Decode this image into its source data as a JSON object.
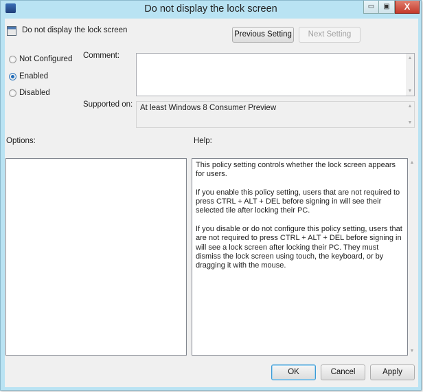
{
  "window": {
    "title": "Do not display the lock screen",
    "minimize": "▭",
    "maximize": "▣",
    "close": "X"
  },
  "header": {
    "policy_name": "Do not display the lock screen",
    "previous_label": "Previous Setting",
    "next_label": "Next Setting"
  },
  "state": {
    "options": [
      {
        "label": "Not Configured",
        "selected": false
      },
      {
        "label": "Enabled",
        "selected": true
      },
      {
        "label": "Disabled",
        "selected": false
      }
    ]
  },
  "comment": {
    "label": "Comment:",
    "value": ""
  },
  "supported": {
    "label": "Supported on:",
    "value": "At least Windows 8 Consumer Preview"
  },
  "options_panel": {
    "label": "Options:"
  },
  "help_panel": {
    "label": "Help:",
    "text": "This policy setting controls whether the lock screen appears for users.\n\nIf you enable this policy setting, users that are not required to press CTRL + ALT + DEL before signing in will see their selected tile after  locking their PC.\n\nIf you disable or do not configure this policy setting, users that are not required to press CTRL + ALT + DEL before signing in will see a lock screen after locking their PC. They must dismiss the lock screen using touch, the keyboard, or by dragging it with the mouse."
  },
  "footer": {
    "ok": "OK",
    "cancel": "Cancel",
    "apply": "Apply"
  }
}
